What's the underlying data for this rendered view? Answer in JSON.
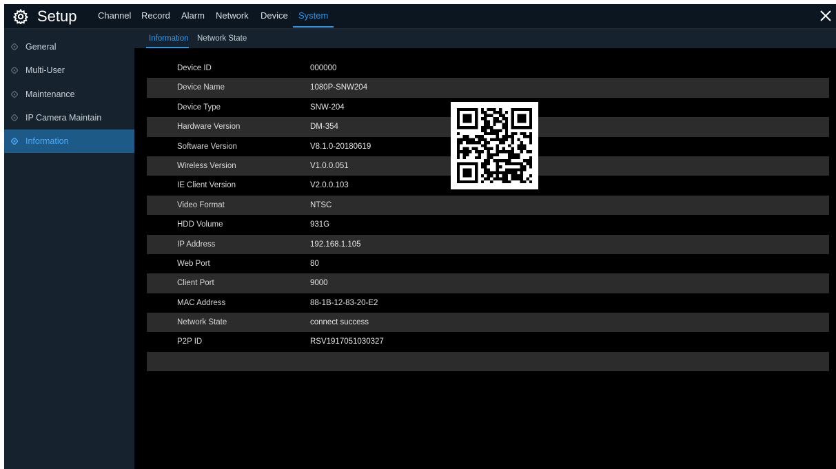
{
  "header": {
    "title": "Setup",
    "menu": [
      {
        "label": "Channel",
        "active": false
      },
      {
        "label": "Record",
        "active": false
      },
      {
        "label": "Alarm",
        "active": false
      },
      {
        "label": "Network",
        "active": false
      },
      {
        "label": "Device",
        "active": false
      },
      {
        "label": "System",
        "active": true
      }
    ]
  },
  "sidebar": {
    "items": [
      {
        "label": "General",
        "active": false
      },
      {
        "label": "Multi-User",
        "active": false
      },
      {
        "label": "Maintenance",
        "active": false
      },
      {
        "label": "IP Camera Maintain",
        "active": false
      },
      {
        "label": "Information",
        "active": true
      }
    ]
  },
  "subtabs": [
    {
      "label": "Information",
      "active": true
    },
    {
      "label": "Network State",
      "active": false
    }
  ],
  "info": [
    {
      "key": "Device ID",
      "value": "000000"
    },
    {
      "key": "Device Name",
      "value": "1080P-SNW204"
    },
    {
      "key": "Device Type",
      "value": "SNW-204"
    },
    {
      "key": "Hardware Version",
      "value": "DM-354"
    },
    {
      "key": "Software Version",
      "value": "V8.1.0-20180619"
    },
    {
      "key": "Wireless Version",
      "value": "V1.0.0.051"
    },
    {
      "key": "IE Client Version",
      "value": "V2.0.0.103"
    },
    {
      "key": "Video Format",
      "value": "NTSC"
    },
    {
      "key": "HDD Volume",
      "value": "931G"
    },
    {
      "key": "IP Address",
      "value": "192.168.1.105"
    },
    {
      "key": "Web Port",
      "value": "80"
    },
    {
      "key": "Client Port",
      "value": "9000"
    },
    {
      "key": "MAC Address",
      "value": "88-1B-12-83-20-E2"
    },
    {
      "key": "Network State",
      "value": "connect success"
    },
    {
      "key": "P2P ID",
      "value": "RSV1917051030327"
    },
    {
      "key": "",
      "value": ""
    }
  ],
  "icons": {
    "gear": "gear-icon",
    "close": "close-icon",
    "bullet": "diamond-bullet-icon",
    "qr": "qr-code-icon"
  },
  "colors": {
    "accent": "#2f95e6",
    "sidebar_bg": "#16232f",
    "active_item_bg": "#1e5a87",
    "row_shade": "#2c2c2c"
  }
}
